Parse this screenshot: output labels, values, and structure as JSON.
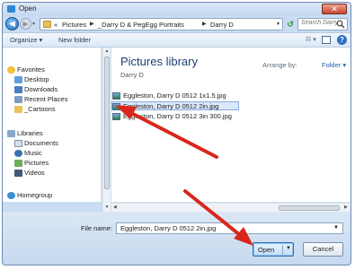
{
  "window": {
    "title": "Open",
    "close_glyph": "✕"
  },
  "address": {
    "back_glyph": "◀",
    "forward_glyph": "▶",
    "breadcrumb": [
      "«",
      "Pictures",
      "_Darry D & PegEgg Portraits",
      "Darry D"
    ],
    "separator": "▶",
    "refresh_glyph": "↺"
  },
  "search": {
    "placeholder": "Search Darry D"
  },
  "toolbar": {
    "organize": "Organize ▾",
    "new_folder": "New folder",
    "views_glyph": "☷ ▾",
    "help": "?"
  },
  "nav": {
    "favorites": {
      "label": "Favorites",
      "items": [
        "Desktop",
        "Downloads",
        "Recent Places",
        "_Cartoons"
      ]
    },
    "libraries": {
      "label": "Libraries",
      "items": [
        "Documents",
        "Music",
        "Pictures",
        "Videos"
      ]
    },
    "homegroup": "Homegroup"
  },
  "library": {
    "title": "Pictures library",
    "subtitle": "Darry D",
    "arrange_label": "Arrange by:",
    "arrange_value": "Folder ▾"
  },
  "files": [
    {
      "name": "Eggleston, Darry D 0512 1x1.5.jpg",
      "selected": false
    },
    {
      "name": "Eggleston, Darry D 0512 2in.jpg",
      "selected": true
    },
    {
      "name": "Eggleston, Darry D 0512 3in 300.jpg",
      "selected": false
    }
  ],
  "filename": {
    "label": "File name:",
    "value": "Eggleston, Darry D 0512 2in.jpg"
  },
  "buttons": {
    "open": "Open",
    "cancel": "Cancel"
  },
  "colors": {
    "annotation_arrow": "#d9261c",
    "accent": "#1e3d73",
    "selection": "#d9e8fb"
  }
}
